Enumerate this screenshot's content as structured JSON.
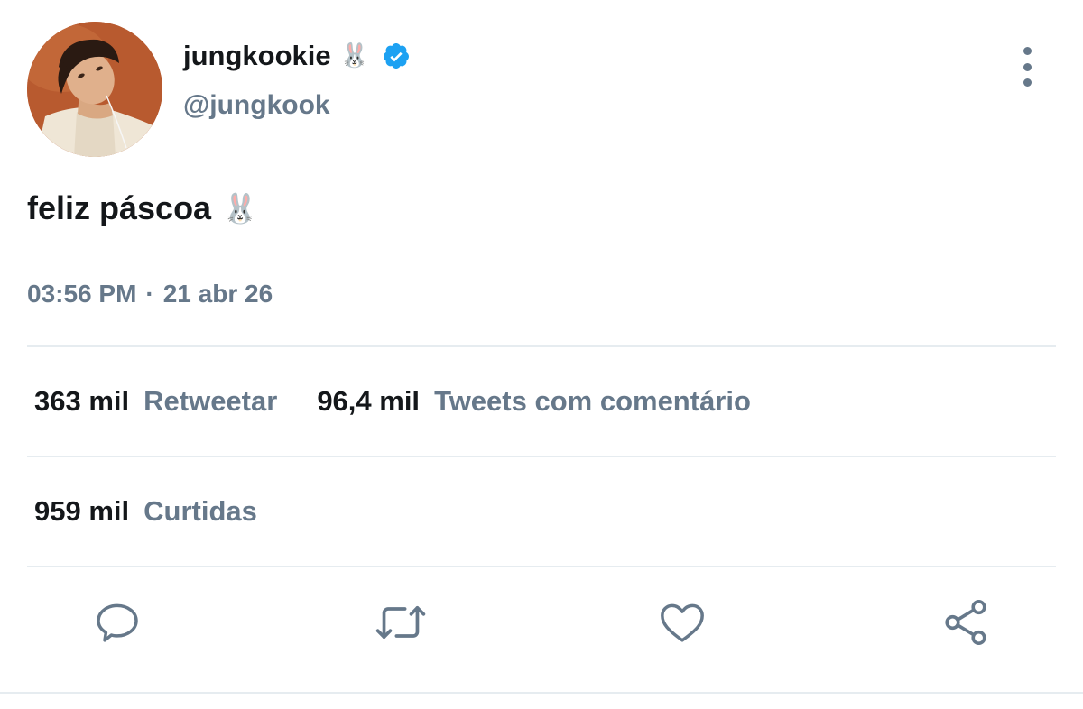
{
  "tweet": {
    "author": {
      "display_name": "jungkookie",
      "name_emoji": "🐰",
      "verified": true,
      "handle": "@jungkook",
      "avatar_icon": "profile-photo"
    },
    "text": "feliz páscoa",
    "text_emoji": "🐰",
    "timestamp": {
      "time": "03:56 PM",
      "separator": "·",
      "date": "21 abr 26"
    },
    "stats": {
      "retweets": {
        "count": "363 mil",
        "label": "Retweetar"
      },
      "quote_tweets": {
        "count": "96,4 mil",
        "label": "Tweets com comentário"
      },
      "likes": {
        "count": "959 mil",
        "label": "Curtidas"
      }
    },
    "actions": [
      {
        "name": "reply",
        "icon": "comment-icon"
      },
      {
        "name": "retweet",
        "icon": "retweet-icon"
      },
      {
        "name": "like",
        "icon": "heart-icon"
      },
      {
        "name": "share",
        "icon": "share-icon"
      }
    ]
  },
  "colors": {
    "primary_text": "#14171a",
    "secondary_text": "#66788a",
    "verified_blue": "#1da1f2",
    "divider": "#e6ecf0"
  }
}
